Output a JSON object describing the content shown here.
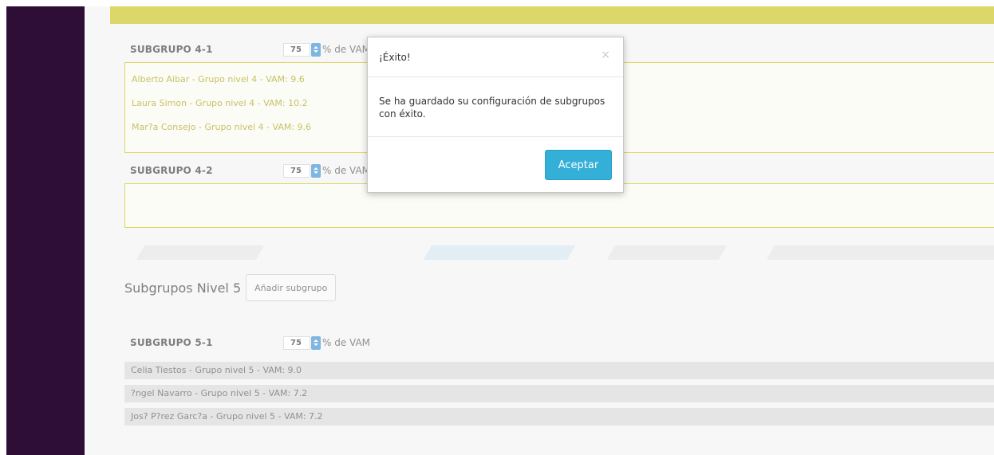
{
  "subgroups_level4": [
    {
      "title": "SUBGRUPO 4-1",
      "vam_value": "75",
      "vam_label": "% de VAM",
      "members": [
        "Alberto Aibar - Grupo nivel 4 - VAM: 9.6",
        "Laura Simon - Grupo nivel 4 - VAM: 10.2",
        "Mar?a Consejo - Grupo nivel 4 - VAM: 9.6"
      ]
    },
    {
      "title": "SUBGRUPO 4-2",
      "vam_value": "75",
      "vam_label": "% de VAM",
      "members": []
    }
  ],
  "level5": {
    "section_title": "Subgrupos Nivel 5",
    "add_button_label": "Añadir subgrupo",
    "subgroups": [
      {
        "title": "SUBGRUPO 5-1",
        "vam_value": "75",
        "vam_label": "% de VAM",
        "members": [
          "Celia Tiestos - Grupo nivel 5 - VAM: 9.0",
          "?ngel Navarro - Grupo nivel 5 - VAM: 7.2",
          "Jos? P?rez Garc?a - Grupo nivel 5 - VAM: 7.2"
        ]
      }
    ]
  },
  "modal": {
    "title": "¡Éxito!",
    "close_icon": "×",
    "message": "Se ha guardado su configuración de subgrupos con éxito.",
    "accept_label": "Aceptar"
  },
  "colors": {
    "sidebar": "#2e0d36",
    "accent_yellow": "#c8c21a",
    "primary_button": "#34b0d8",
    "spinner_blue": "#3b8fd0"
  }
}
